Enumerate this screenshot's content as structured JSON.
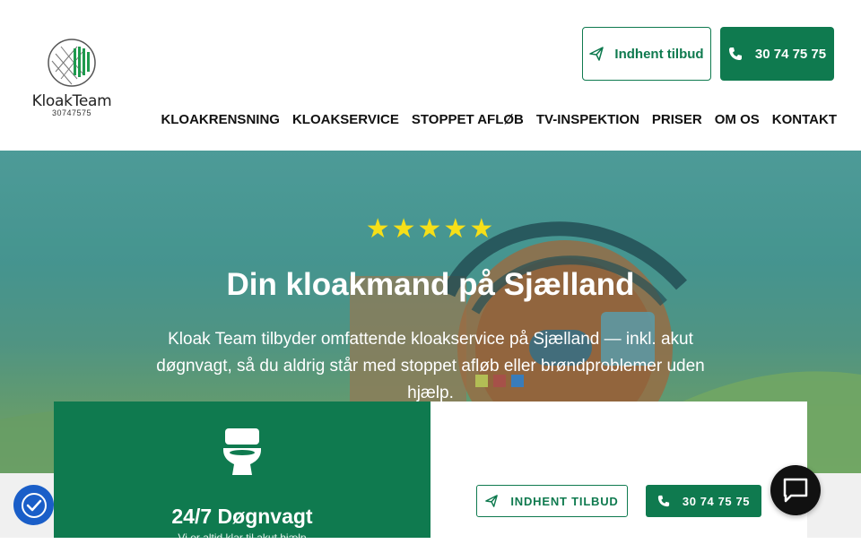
{
  "logo": {
    "name": "KloakTeam",
    "phone": "30747575"
  },
  "header": {
    "offer_label": "Indhent tilbud",
    "phone_label": "30 74 75 75"
  },
  "nav": [
    "KLOAKRENSNING",
    "KLOAKSERVICE",
    "STOPPET AFLØB",
    "TV-INSPEKTION",
    "PRISER",
    "OM OS",
    "KONTAKT"
  ],
  "hero": {
    "stars": "★★★★★",
    "rating": 5,
    "title": "Din kloakmand på Sjælland",
    "text": "Kloak Team tilbyder omfattende kloakservice på Sjælland — inkl. akut døgnvagt, så du aldrig står med stoppet afløb eller brøndproblemer uden hjælp."
  },
  "card": {
    "icon": "toilet-icon",
    "title": "24/7 Døgnvagt",
    "subtitle": "Vi er altid klar til akut hjælp"
  },
  "cta": {
    "offer_label": "INDHENT TILBUD",
    "phone_label": "30 74 75 75"
  },
  "colors": {
    "brand": "#0f7a4f",
    "star": "#f6df18",
    "accessibility": "#1a5ec8"
  }
}
